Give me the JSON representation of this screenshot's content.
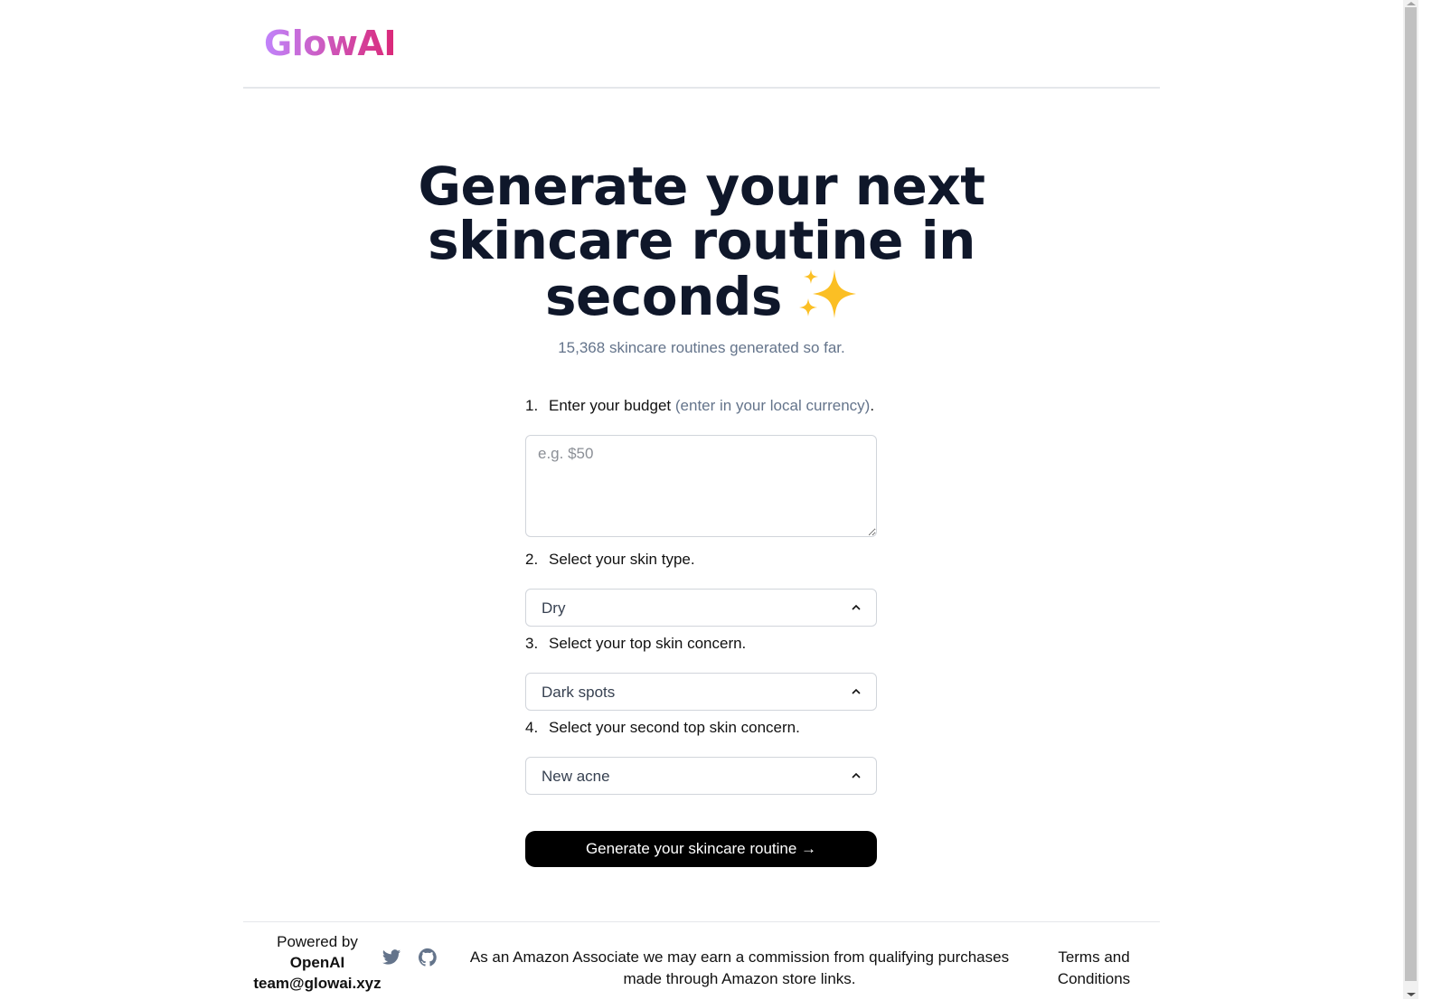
{
  "brand": {
    "logo_text": "GlowAI",
    "gradient_start": "#c084fc",
    "gradient_end": "#db2777"
  },
  "hero": {
    "title": "Generate your next skincare routine in seconds",
    "emoji_icon": "sparkles-icon",
    "counter_text": "15,368 skincare routines generated so far."
  },
  "form": {
    "step1": {
      "number": "1.",
      "label": "Enter your budget",
      "hint": "(enter in your local currency)",
      "suffix": ".",
      "input_value": "",
      "placeholder": "e.g. $50"
    },
    "step2": {
      "number": "2.",
      "label": "Select your skin type.",
      "selected": "Dry"
    },
    "step3": {
      "number": "3.",
      "label": "Select your top skin concern.",
      "selected": "Dark spots"
    },
    "step4": {
      "number": "4.",
      "label": "Select your second top skin concern.",
      "selected": "New acne"
    },
    "submit_label": "Generate your skincare routine →"
  },
  "footer": {
    "powered_by": "Powered by",
    "provider": "OpenAI",
    "email": "team@glowai.xyz",
    "social_icons": [
      "twitter-icon",
      "github-icon"
    ],
    "icon_color": "#64748b",
    "disclaimer": "As an Amazon Associate we may earn a commission from qualifying purchases made through Amazon store links.",
    "terms_link": "Terms and Conditions"
  }
}
